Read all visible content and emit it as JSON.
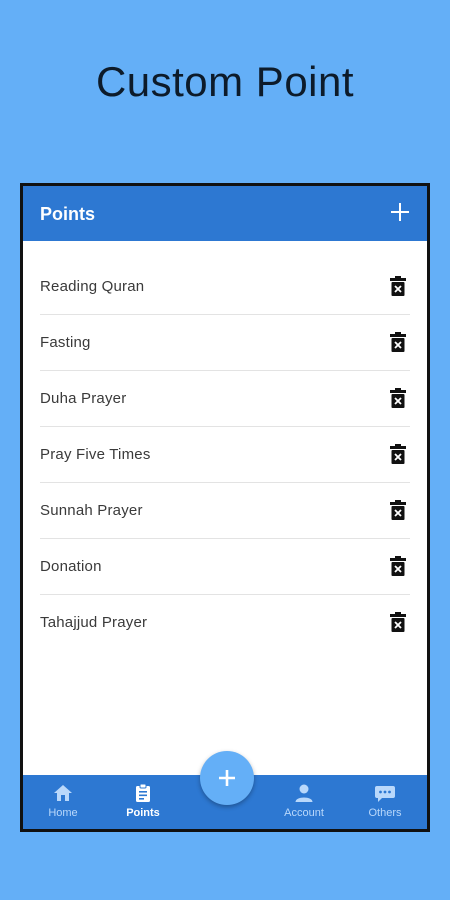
{
  "headline": "Custom Point",
  "appbar": {
    "title": "Points",
    "add_icon": "plus-icon"
  },
  "points": [
    {
      "label": "Reading Quran",
      "icon": "delete-icon"
    },
    {
      "label": "Fasting",
      "icon": "delete-icon"
    },
    {
      "label": "Duha Prayer",
      "icon": "delete-icon"
    },
    {
      "label": "Pray Five Times",
      "icon": "delete-icon"
    },
    {
      "label": "Sunnah Prayer",
      "icon": "delete-icon"
    },
    {
      "label": "Donation",
      "icon": "delete-icon"
    },
    {
      "label": "Tahajjud Prayer",
      "icon": "delete-icon"
    }
  ],
  "bottom_nav": {
    "items": [
      {
        "label": "Home",
        "icon": "home-icon",
        "active": false
      },
      {
        "label": "Points",
        "icon": "clipboard-icon",
        "active": true
      },
      {
        "label": "Account",
        "icon": "person-icon",
        "active": false
      },
      {
        "label": "Others",
        "icon": "chat-dots-icon",
        "active": false
      }
    ],
    "fab_icon": "plus-icon"
  },
  "colors": {
    "background": "#64aff7",
    "primary": "#2d78d2",
    "fab": "#64aff7",
    "nav_inactive": "#b9d8fb"
  }
}
